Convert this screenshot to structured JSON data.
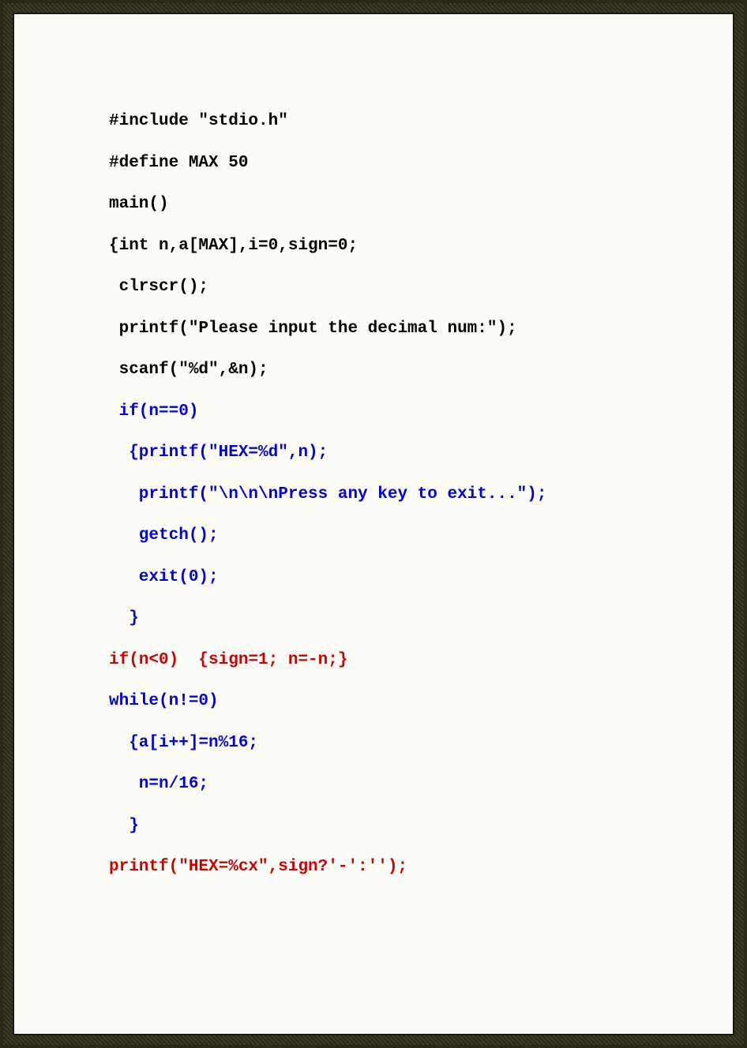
{
  "code": {
    "l1": "#include \"stdio.h\"",
    "l2": "#define MAX 50",
    "l3": "main()",
    "l4": "{int n,a[MAX],i=0,sign=0;",
    "l5": " clrscr();",
    "l6": " printf(\"Please input the decimal num:\");",
    "l7": " scanf(\"%d\",&n);",
    "l8": " if(n==0)",
    "l9": "  {printf(\"HEX=%d\",n);",
    "l10": "   printf(\"\\n\\n\\nPress any key to exit...\");",
    "l11": "   getch();",
    "l12": "   exit(0);",
    "l13": "  }",
    "l14": "if(n<0)  {sign=1; n=-n;}",
    "l15": "while(n!=0)",
    "l16": "  {a[i++]=n%16;",
    "l17": "   n=n/16;",
    "l18": "  }",
    "l19": "printf(\"HEX=%cx\",sign?'-':'');"
  },
  "colors": {
    "default": "#000000",
    "blue": "#0000e0",
    "red": "#d00000"
  }
}
